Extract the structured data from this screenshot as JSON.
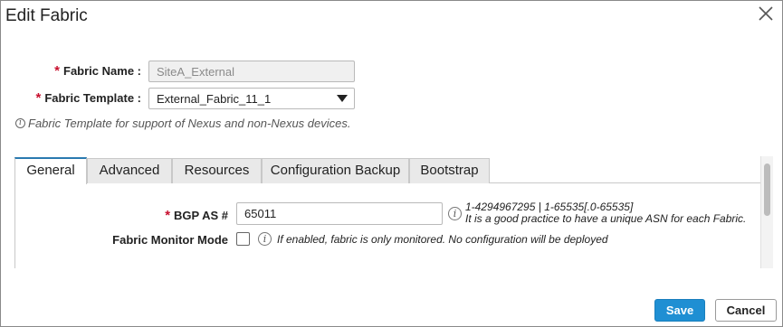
{
  "dialog": {
    "title": "Edit Fabric"
  },
  "form": {
    "fabric_name": {
      "required_mark": "*",
      "label": "Fabric Name :",
      "value": "SiteA_External"
    },
    "fabric_template": {
      "required_mark": "*",
      "label": "Fabric Template :",
      "value": "External_Fabric_11_1"
    },
    "template_hint": "Fabric Template for support of Nexus and non-Nexus devices."
  },
  "tabs": [
    {
      "label": "General",
      "active": true
    },
    {
      "label": "Advanced",
      "active": false
    },
    {
      "label": "Resources",
      "active": false
    },
    {
      "label": "Configuration Backup",
      "active": false
    },
    {
      "label": "Bootstrap",
      "active": false
    }
  ],
  "general": {
    "bgp_as": {
      "required_mark": "*",
      "label": "BGP AS #",
      "value": "65011",
      "help_line1": "1-4294967295 | 1-65535[.0-65535]",
      "help_line2": "It is a good practice to have a unique ASN for each Fabric."
    },
    "fabric_monitor_mode": {
      "label": "Fabric Monitor Mode",
      "checked": false,
      "help": "If enabled, fabric is only monitored. No configuration will be deployed"
    }
  },
  "footer": {
    "save_label": "Save",
    "cancel_label": "Cancel"
  },
  "icons": {
    "info_glyph": "i",
    "close_icon": "close-icon"
  },
  "colors": {
    "primary": "#1f8fd3",
    "required": "#c8102e",
    "active_tab_accent": "#2a7ab0"
  }
}
